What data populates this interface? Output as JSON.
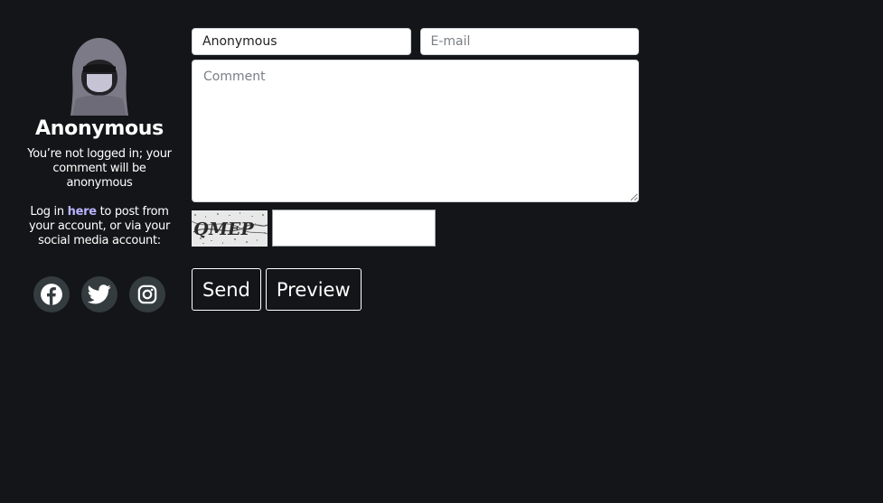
{
  "profile": {
    "username": "Anonymous",
    "note": "You’re not logged in; your comment will be anonymous",
    "login_prefix": "Log in ",
    "login_link": "here",
    "login_suffix": " to post from your account, or via your social media account:",
    "socials": [
      "facebook-icon",
      "twitter-icon",
      "instagram-icon"
    ]
  },
  "form": {
    "name_value": "Anonymous",
    "email_placeholder": "E-mail",
    "comment_placeholder": "Comment",
    "captcha_text": "QMEP",
    "send_label": "Send",
    "preview_label": "Preview"
  },
  "colors": {
    "background": "#141518",
    "link": "#b8b3ff",
    "social_bg": "#343c40"
  }
}
